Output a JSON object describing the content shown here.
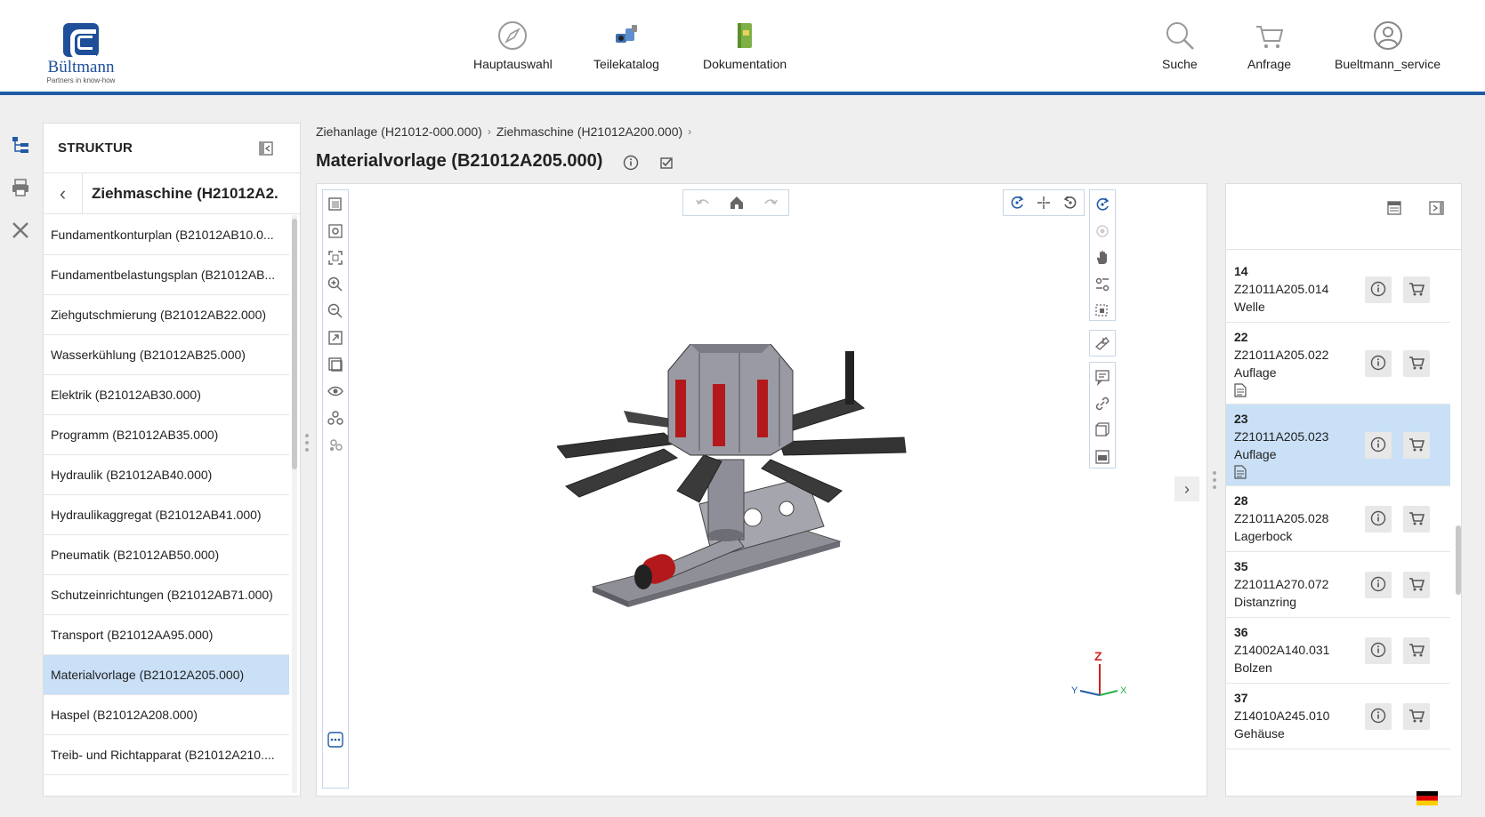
{
  "header": {
    "logo_name": "Bültmann",
    "logo_tagline": "Partners in know-how",
    "nav": [
      {
        "label": "Hauptauswahl",
        "icon": "compass-icon"
      },
      {
        "label": "Teilekatalog",
        "icon": "parts-catalog-icon"
      },
      {
        "label": "Dokumentation",
        "icon": "book-icon"
      }
    ],
    "actions": [
      {
        "label": "Suche",
        "icon": "search-icon"
      },
      {
        "label": "Anfrage",
        "icon": "cart-icon"
      },
      {
        "label": "Bueltmann_service",
        "icon": "user-icon"
      }
    ]
  },
  "structure": {
    "title": "STRUKTUR",
    "current": "Ziehmaschine (H21012A2...",
    "items": [
      "Fundamentkonturplan (B21012AB10.0...",
      "Fundamentbelastungsplan (B21012AB...",
      "Ziehgutschmierung (B21012AB22.000)",
      "Wasserkühlung (B21012AB25.000)",
      "Elektrik (B21012AB30.000)",
      "Programm (B21012AB35.000)",
      "Hydraulik (B21012AB40.000)",
      "Hydraulikaggregat (B21012AB41.000)",
      "Pneumatik (B21012AB50.000)",
      "Schutzeinrichtungen (B21012AB71.000)",
      "Transport (B21012AA95.000)",
      "Materialvorlage (B21012A205.000)",
      "Haspel (B21012A208.000)",
      "Treib- und Richtapparat (B21012A210...."
    ],
    "selected_index": 11
  },
  "breadcrumb": [
    "Ziehanlage (H21012-000.000)",
    "Ziehmaschine (H21012A200.000)"
  ],
  "page_title": "Materialvorlage (B21012A205.000)",
  "viewer": {
    "axes": {
      "z": "Z",
      "y": "Y",
      "x": "X"
    }
  },
  "parts": [
    {
      "pos": "14",
      "number": "Z21011A205.014",
      "name": "Welle",
      "doc": false,
      "selected": false
    },
    {
      "pos": "22",
      "number": "Z21011A205.022",
      "name": "Auflage",
      "doc": true,
      "selected": false
    },
    {
      "pos": "23",
      "number": "Z21011A205.023",
      "name": "Auflage",
      "doc": true,
      "selected": true
    },
    {
      "pos": "28",
      "number": "Z21011A205.028",
      "name": "Lagerbock",
      "doc": false,
      "selected": false
    },
    {
      "pos": "35",
      "number": "Z21011A270.072",
      "name": "Distanzring",
      "doc": false,
      "selected": false
    },
    {
      "pos": "36",
      "number": "Z14002A140.031",
      "name": "Bolzen",
      "doc": false,
      "selected": false
    },
    {
      "pos": "37",
      "number": "Z14010A245.010",
      "name": "Gehäuse",
      "doc": false,
      "selected": false
    }
  ],
  "colors": {
    "accent": "#1f5aa6",
    "selection": "#c9e0f7",
    "model_red": "#b3191c"
  }
}
